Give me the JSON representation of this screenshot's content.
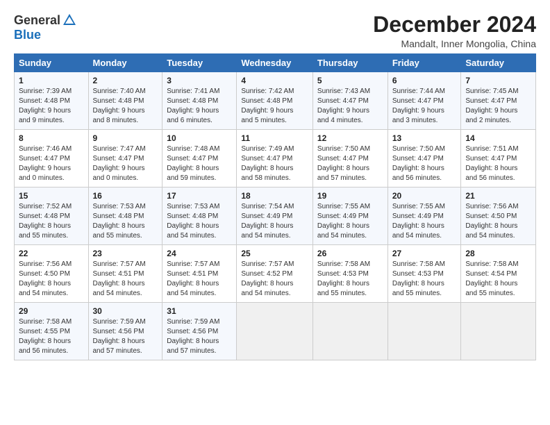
{
  "logo": {
    "general": "General",
    "blue": "Blue"
  },
  "header": {
    "title": "December 2024",
    "subtitle": "Mandalt, Inner Mongolia, China"
  },
  "columns": [
    "Sunday",
    "Monday",
    "Tuesday",
    "Wednesday",
    "Thursday",
    "Friday",
    "Saturday"
  ],
  "weeks": [
    [
      {
        "day": "1",
        "detail": "Sunrise: 7:39 AM\nSunset: 4:48 PM\nDaylight: 9 hours\nand 9 minutes."
      },
      {
        "day": "2",
        "detail": "Sunrise: 7:40 AM\nSunset: 4:48 PM\nDaylight: 9 hours\nand 8 minutes."
      },
      {
        "day": "3",
        "detail": "Sunrise: 7:41 AM\nSunset: 4:48 PM\nDaylight: 9 hours\nand 6 minutes."
      },
      {
        "day": "4",
        "detail": "Sunrise: 7:42 AM\nSunset: 4:48 PM\nDaylight: 9 hours\nand 5 minutes."
      },
      {
        "day": "5",
        "detail": "Sunrise: 7:43 AM\nSunset: 4:47 PM\nDaylight: 9 hours\nand 4 minutes."
      },
      {
        "day": "6",
        "detail": "Sunrise: 7:44 AM\nSunset: 4:47 PM\nDaylight: 9 hours\nand 3 minutes."
      },
      {
        "day": "7",
        "detail": "Sunrise: 7:45 AM\nSunset: 4:47 PM\nDaylight: 9 hours\nand 2 minutes."
      }
    ],
    [
      {
        "day": "8",
        "detail": "Sunrise: 7:46 AM\nSunset: 4:47 PM\nDaylight: 9 hours\nand 0 minutes."
      },
      {
        "day": "9",
        "detail": "Sunrise: 7:47 AM\nSunset: 4:47 PM\nDaylight: 9 hours\nand 0 minutes."
      },
      {
        "day": "10",
        "detail": "Sunrise: 7:48 AM\nSunset: 4:47 PM\nDaylight: 8 hours\nand 59 minutes."
      },
      {
        "day": "11",
        "detail": "Sunrise: 7:49 AM\nSunset: 4:47 PM\nDaylight: 8 hours\nand 58 minutes."
      },
      {
        "day": "12",
        "detail": "Sunrise: 7:50 AM\nSunset: 4:47 PM\nDaylight: 8 hours\nand 57 minutes."
      },
      {
        "day": "13",
        "detail": "Sunrise: 7:50 AM\nSunset: 4:47 PM\nDaylight: 8 hours\nand 56 minutes."
      },
      {
        "day": "14",
        "detail": "Sunrise: 7:51 AM\nSunset: 4:47 PM\nDaylight: 8 hours\nand 56 minutes."
      }
    ],
    [
      {
        "day": "15",
        "detail": "Sunrise: 7:52 AM\nSunset: 4:48 PM\nDaylight: 8 hours\nand 55 minutes."
      },
      {
        "day": "16",
        "detail": "Sunrise: 7:53 AM\nSunset: 4:48 PM\nDaylight: 8 hours\nand 55 minutes."
      },
      {
        "day": "17",
        "detail": "Sunrise: 7:53 AM\nSunset: 4:48 PM\nDaylight: 8 hours\nand 54 minutes."
      },
      {
        "day": "18",
        "detail": "Sunrise: 7:54 AM\nSunset: 4:49 PM\nDaylight: 8 hours\nand 54 minutes."
      },
      {
        "day": "19",
        "detail": "Sunrise: 7:55 AM\nSunset: 4:49 PM\nDaylight: 8 hours\nand 54 minutes."
      },
      {
        "day": "20",
        "detail": "Sunrise: 7:55 AM\nSunset: 4:49 PM\nDaylight: 8 hours\nand 54 minutes."
      },
      {
        "day": "21",
        "detail": "Sunrise: 7:56 AM\nSunset: 4:50 PM\nDaylight: 8 hours\nand 54 minutes."
      }
    ],
    [
      {
        "day": "22",
        "detail": "Sunrise: 7:56 AM\nSunset: 4:50 PM\nDaylight: 8 hours\nand 54 minutes."
      },
      {
        "day": "23",
        "detail": "Sunrise: 7:57 AM\nSunset: 4:51 PM\nDaylight: 8 hours\nand 54 minutes."
      },
      {
        "day": "24",
        "detail": "Sunrise: 7:57 AM\nSunset: 4:51 PM\nDaylight: 8 hours\nand 54 minutes."
      },
      {
        "day": "25",
        "detail": "Sunrise: 7:57 AM\nSunset: 4:52 PM\nDaylight: 8 hours\nand 54 minutes."
      },
      {
        "day": "26",
        "detail": "Sunrise: 7:58 AM\nSunset: 4:53 PM\nDaylight: 8 hours\nand 55 minutes."
      },
      {
        "day": "27",
        "detail": "Sunrise: 7:58 AM\nSunset: 4:53 PM\nDaylight: 8 hours\nand 55 minutes."
      },
      {
        "day": "28",
        "detail": "Sunrise: 7:58 AM\nSunset: 4:54 PM\nDaylight: 8 hours\nand 55 minutes."
      }
    ],
    [
      {
        "day": "29",
        "detail": "Sunrise: 7:58 AM\nSunset: 4:55 PM\nDaylight: 8 hours\nand 56 minutes."
      },
      {
        "day": "30",
        "detail": "Sunrise: 7:59 AM\nSunset: 4:56 PM\nDaylight: 8 hours\nand 57 minutes."
      },
      {
        "day": "31",
        "detail": "Sunrise: 7:59 AM\nSunset: 4:56 PM\nDaylight: 8 hours\nand 57 minutes."
      },
      {
        "day": "",
        "detail": ""
      },
      {
        "day": "",
        "detail": ""
      },
      {
        "day": "",
        "detail": ""
      },
      {
        "day": "",
        "detail": ""
      }
    ]
  ]
}
